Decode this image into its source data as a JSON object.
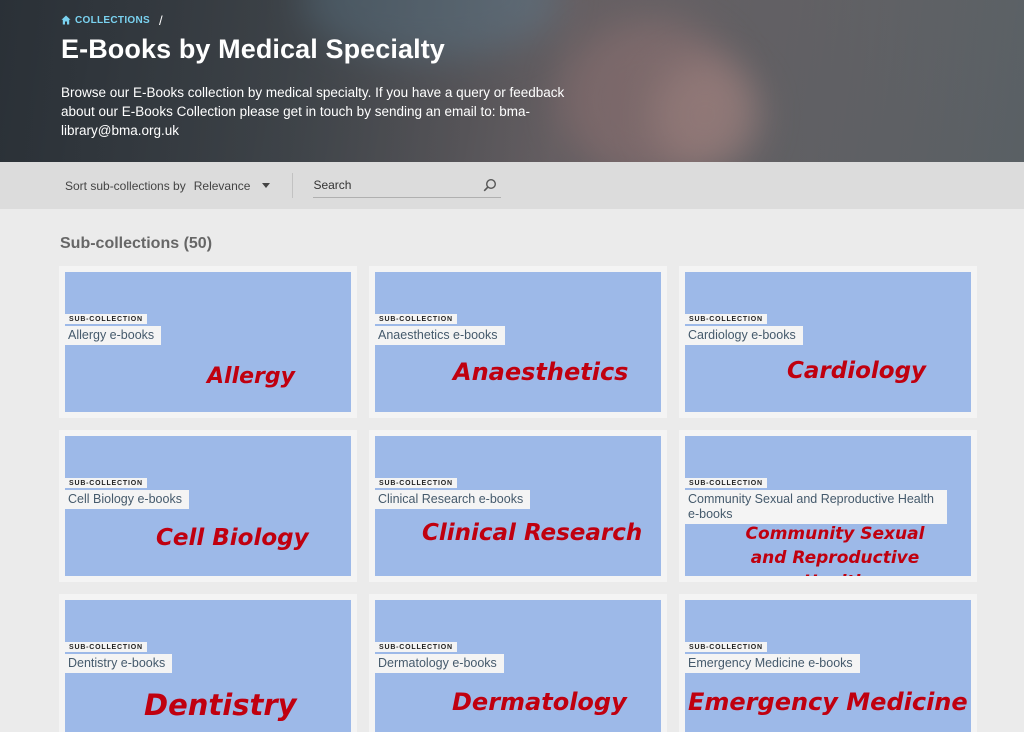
{
  "breadcrumb": {
    "home_label": "COLLECTIONS",
    "separator": "/"
  },
  "page": {
    "title": "E-Books by Medical Specialty",
    "description": "Browse our E-Books collection by medical specialty. If you have a query or feedback about our E-Books Collection please get in touch by sending an email to: bma-library@bma.org.uk"
  },
  "toolbar": {
    "sort_label": "Sort sub-collections by",
    "sort_value": "Relevance",
    "search_placeholder": "Search"
  },
  "main": {
    "section_title": "Sub-collections (50)",
    "cards": [
      {
        "kicker": "SUB-COLLECTION",
        "name": "Allergy e-books",
        "art": "Allergy"
      },
      {
        "kicker": "SUB-COLLECTION",
        "name": "Anaesthetics e-books",
        "art": "Anaesthetics"
      },
      {
        "kicker": "SUB-COLLECTION",
        "name": "Cardiology e-books",
        "art": "Cardiology"
      },
      {
        "kicker": "SUB-COLLECTION",
        "name": "Cell Biology e-books",
        "art": "Cell Biology"
      },
      {
        "kicker": "SUB-COLLECTION",
        "name": "Clinical Research e-books",
        "art": "Clinical Research"
      },
      {
        "kicker": "SUB-COLLECTION",
        "name": "Community Sexual and Reproductive Health e-books",
        "art": "Community Sexual and Reproductive Health"
      },
      {
        "kicker": "SUB-COLLECTION",
        "name": "Dentistry e-books",
        "art": "Dentistry"
      },
      {
        "kicker": "SUB-COLLECTION",
        "name": "Dermatology e-books",
        "art": "Dermatology"
      },
      {
        "kicker": "SUB-COLLECTION",
        "name": "Emergency Medicine e-books",
        "art": "Emergency Medicine"
      }
    ]
  },
  "colors": {
    "card_art_bg": "#9db9e8",
    "card_art_text": "#c0000f",
    "breadcrumb_link": "#7ad2f0"
  },
  "icons": {
    "home": "home-icon",
    "search": "search-icon",
    "sort": "chevron-down-icon"
  }
}
